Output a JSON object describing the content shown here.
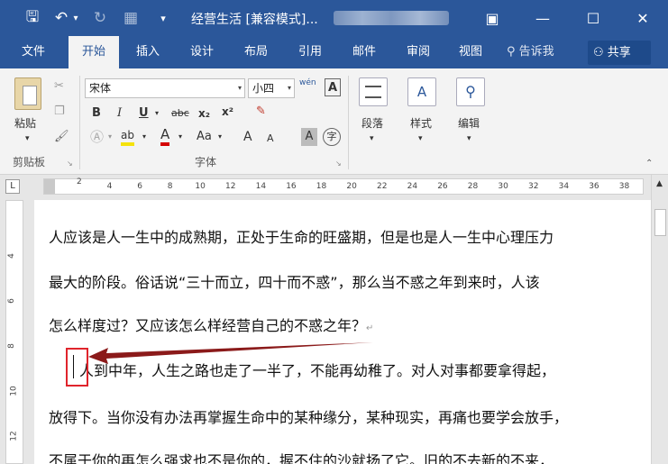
{
  "window": {
    "title": "经营生活 [兼容模式]...",
    "quick_access": {
      "save": "🖫",
      "undo": "↶",
      "undo_dd": "▾",
      "redo": "↻",
      "print": "▦",
      "more": "▾"
    },
    "buttons": {
      "ribbon_opts": "▣",
      "minimize": "—",
      "maximize": "☐",
      "close": "✕"
    }
  },
  "tabs": [
    {
      "label": "文件"
    },
    {
      "label": "开始"
    },
    {
      "label": "插入"
    },
    {
      "label": "设计"
    },
    {
      "label": "布局"
    },
    {
      "label": "引用"
    },
    {
      "label": "邮件"
    },
    {
      "label": "审阅"
    },
    {
      "label": "视图"
    }
  ],
  "tell_me": "告诉我",
  "share": "共享",
  "ribbon": {
    "clipboard": {
      "paste": "粘贴",
      "group": "剪贴板"
    },
    "font": {
      "name": "宋体",
      "size": "小四",
      "phonetic": "wén",
      "group": "字体",
      "bold": "B",
      "italic": "I",
      "underline": "U",
      "strike": "abc",
      "sub": "x₂",
      "sup": "x²",
      "highlight": "ab",
      "color": "A",
      "case": "Aa",
      "grow": "A",
      "shrink": "A",
      "clear": "A",
      "enclose": "字"
    },
    "paragraph": "段落",
    "styles": "样式",
    "editing": "编辑"
  },
  "ruler": {
    "tab_selector": "L",
    "ticks": [
      "2",
      "4",
      "6",
      "8",
      "10",
      "12",
      "14",
      "16",
      "18",
      "20",
      "22",
      "24",
      "26",
      "28",
      "30",
      "32",
      "34",
      "36",
      "38"
    ]
  },
  "vruler_ticks": [
    "4",
    "6",
    "8",
    "10",
    "12",
    "14"
  ],
  "document": {
    "lines": [
      "人应该是人一生中的成熟期，正处于生命的旺盛期，但是也是人一生中心理压力",
      "最大的阶段。俗话说“三十而立，四十而不惑”，那么当不惑之年到来时，人该",
      "怎么样度过？又应该怎么样经营自己的不惑之年？",
      "人到中年，人生之路也走了一半了，不能再幼稚了。对人对事都要拿得起，",
      "放得下。当你没有办法再掌握生命中的某种缘分，某种现实，再痛也要学会放手，",
      "不属于你的再怎么强求也不是你的，握不住的沙就扬了它。旧的不去新的不来，"
    ],
    "paragraph_mark": "↵"
  }
}
